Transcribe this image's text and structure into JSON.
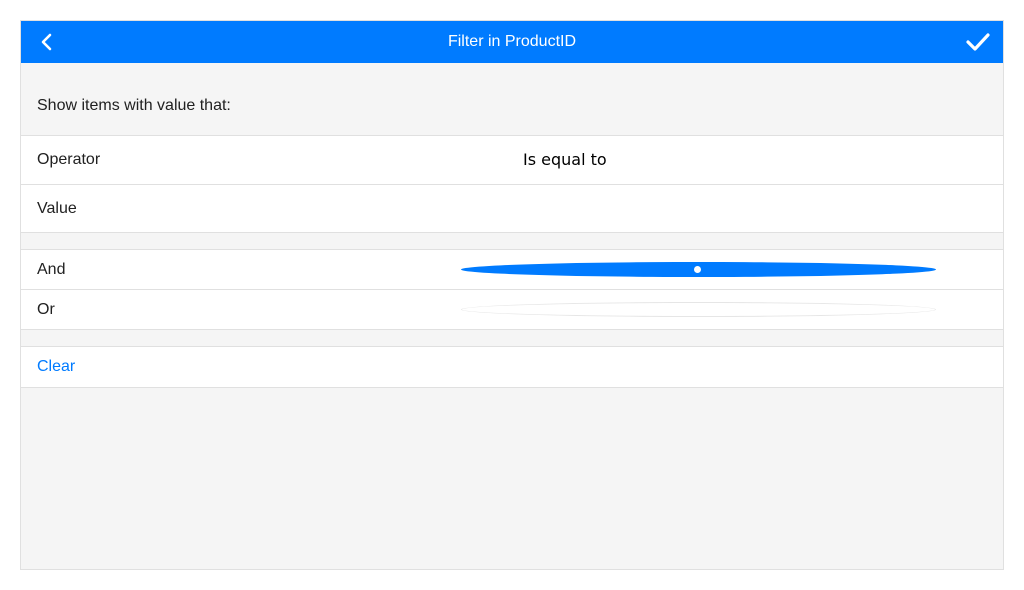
{
  "header": {
    "title": "Filter in ProductID",
    "back_icon": "chevron-left-icon",
    "ok_icon": "checkmark-icon",
    "color": "#007bff"
  },
  "hint": "Show items with value that:",
  "operator": {
    "label": "Operator",
    "value": "Is equal to"
  },
  "value_field": {
    "label": "Value",
    "value": ""
  },
  "logic": {
    "and_label": "And",
    "or_label": "Or",
    "selected": "And"
  },
  "clear_label": "Clear",
  "colors": {
    "accent": "#007bff",
    "background": "#f5f5f5",
    "border": "#e0e0e0"
  }
}
